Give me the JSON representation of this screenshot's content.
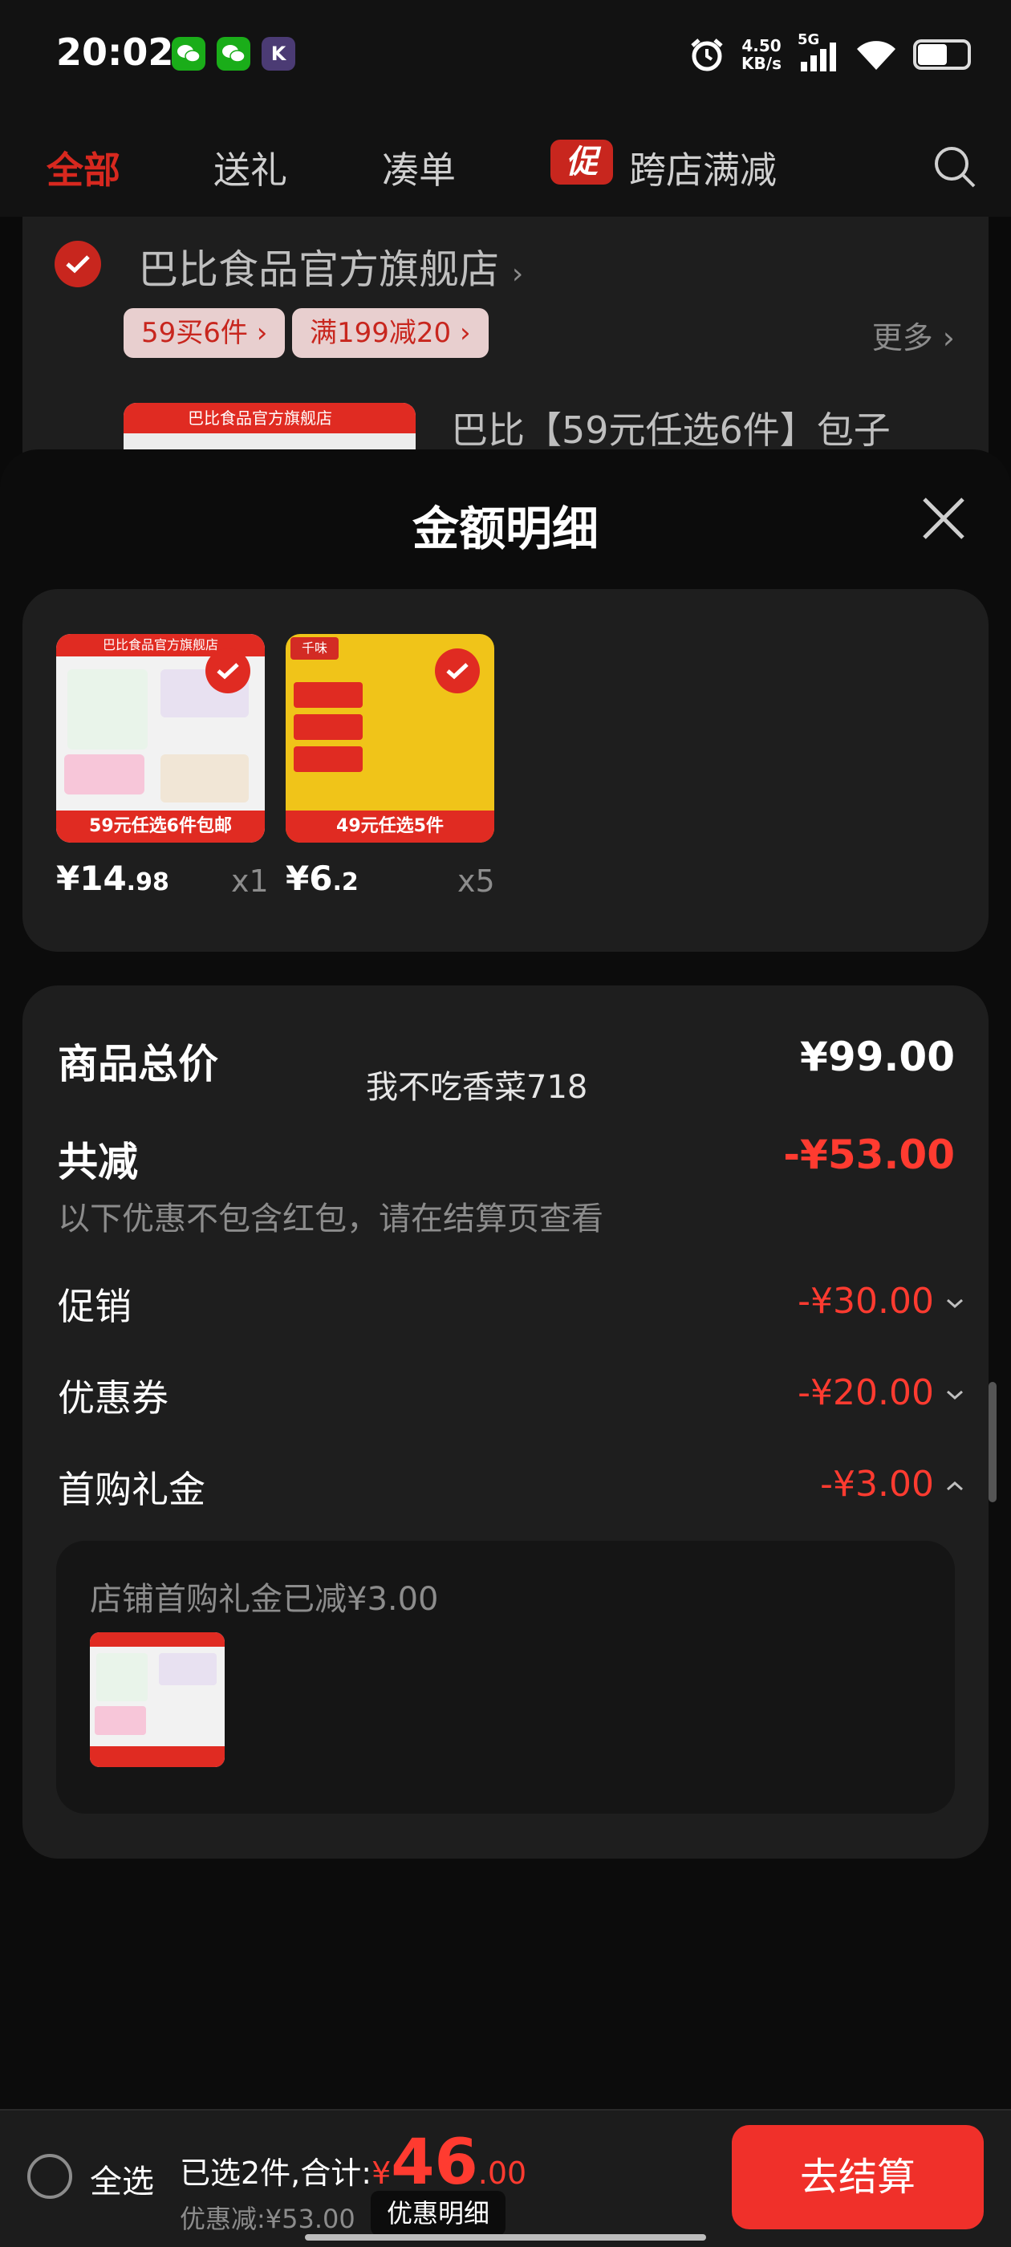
{
  "status_bar": {
    "time": "20:02",
    "speed_value": "4.50",
    "speed_unit": "KB/s",
    "network": "5G",
    "app_icons": [
      "wechat-icon",
      "wechat-icon",
      "k-app-icon"
    ],
    "k_letter": "K"
  },
  "tabs": {
    "all": "全部",
    "gift": "送礼",
    "bundle": "凑单",
    "promo_badge": "促",
    "cross_store": "跨店满减"
  },
  "store": {
    "name": "巴比食品官方旗舰店",
    "promo_tags": [
      "59买6件",
      "满199减20"
    ],
    "more": "更多",
    "thumb_banner": "巴比食品官方旗舰店",
    "product_title": "巴比【59元任选6件】包子"
  },
  "sheet": {
    "title": "金额明细"
  },
  "items": [
    {
      "price_int": "¥14",
      "price_dec": ".98",
      "qty": "x1",
      "banner": "59元任选6件包邮",
      "top": "巴比食品官方旗舰店"
    },
    {
      "price_int": "¥6",
      "price_dec": ".2",
      "qty": "x5",
      "banner": "49元任选5件",
      "top": "千味"
    }
  ],
  "summary": {
    "total_label": "商品总价",
    "total_value": "¥99.00",
    "watermark": "我不吃香菜718",
    "reduce_label": "共减",
    "reduce_value": "-¥53.00",
    "note": "以下优惠不包含红包，请在结算页查看",
    "promo_label": "促销",
    "promo_value": "-¥30.00",
    "coupon_label": "优惠券",
    "coupon_value": "-¥20.00",
    "first_label": "首购礼金",
    "first_value": "-¥3.00",
    "first_detail": "店铺首购礼金已减¥3.00"
  },
  "bottom": {
    "select_all": "全选",
    "selected_text": "已选2件,合计:",
    "currency": "¥",
    "total_int": "46",
    "total_dec": ".00",
    "discount_text": "优惠减:¥53.00",
    "detail_button": "优惠明细",
    "checkout": "去结算"
  },
  "colors": {
    "accent_red": "#ff3b30",
    "brand_red": "#c8261e",
    "card_bg": "#1e1e1e",
    "sheet_bg": "#0c0c0c"
  }
}
